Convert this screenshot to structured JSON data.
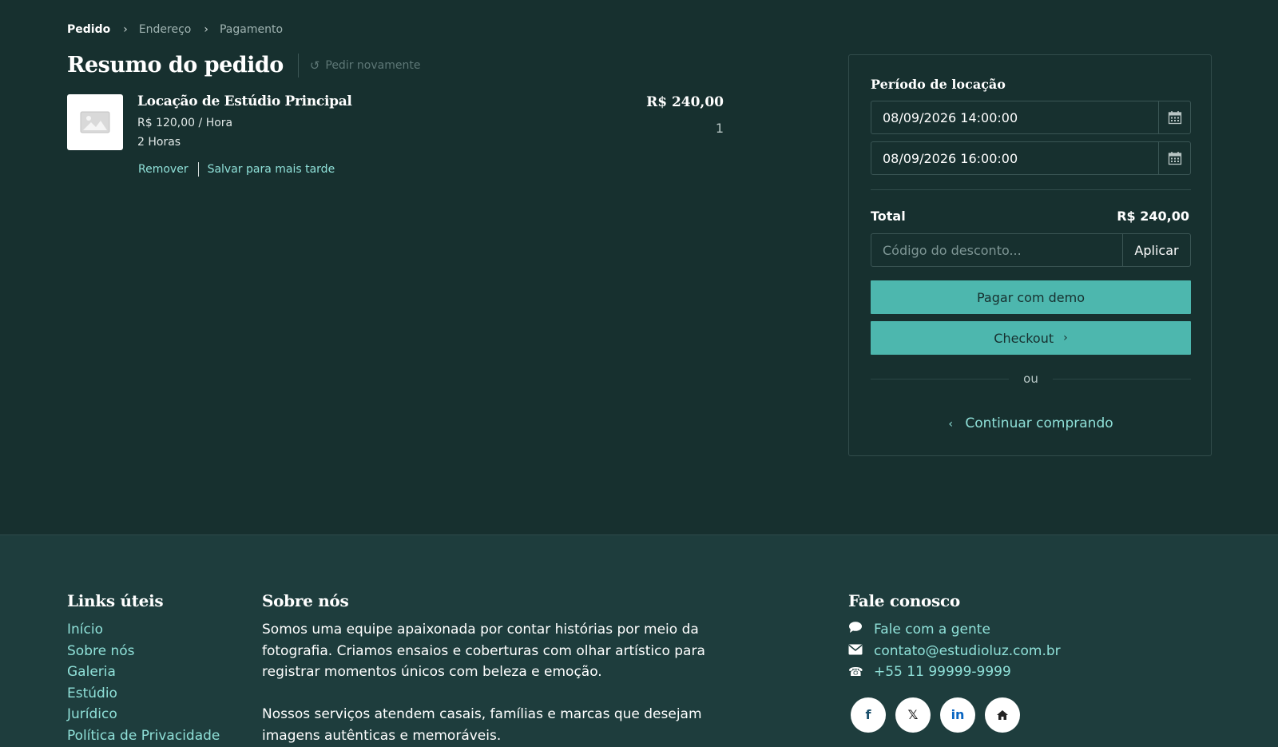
{
  "breadcrumb": {
    "items": [
      {
        "label": "Pedido",
        "active": true
      },
      {
        "label": "Endereço",
        "active": false
      },
      {
        "label": "Pagamento",
        "active": false
      }
    ],
    "separator": ">"
  },
  "header": {
    "title": "Resumo do pedido",
    "reorder_label": "Pedir novamente"
  },
  "item": {
    "name": "Locação de Estúdio Principal",
    "unit_price": "R$ 120,00 / Hora",
    "quantity_text": "2 Horas",
    "remove_label": "Remover",
    "save_later_label": "Salvar para mais tarde",
    "price": "R$ 240,00",
    "count": "1"
  },
  "summary": {
    "period_label": "Período de locação",
    "start_datetime": "08/09/2026 14:00:00",
    "end_datetime": "08/09/2026 16:00:00",
    "total_label": "Total",
    "total_value": "R$ 240,00",
    "discount_placeholder": "Código do desconto...",
    "apply_label": "Aplicar",
    "pay_demo_label": "Pagar com demo",
    "checkout_label": "Checkout",
    "or_label": "ou",
    "continue_label": "Continuar comprando"
  },
  "footer": {
    "links": {
      "heading": "Links úteis",
      "items": [
        "Início",
        "Sobre nós",
        "Galeria",
        "Estúdio",
        "Jurídico",
        "Política de Privacidade"
      ]
    },
    "about": {
      "heading": "Sobre nós",
      "paragraphs": [
        "Somos uma equipe apaixonada por contar histórias por meio da fotografia. Criamos ensaios e coberturas com olhar artístico para registrar momentos únicos com beleza e emoção.",
        "Nossos serviços atendem casais, famílias e marcas que desejam imagens autênticas e memoráveis."
      ]
    },
    "contact": {
      "heading": "Fale conosco",
      "chat": "Fale com a gente",
      "email": "contato@estudioluz.com.br",
      "phone": "+55 11 99999-9999"
    },
    "socials": [
      "facebook-icon",
      "x-icon",
      "linkedin-icon",
      "home-icon"
    ]
  },
  "colors": {
    "background": "#17302f",
    "footer_background": "#1e3d3d",
    "accent": "#4db7ae",
    "link": "#8fe0d8"
  }
}
